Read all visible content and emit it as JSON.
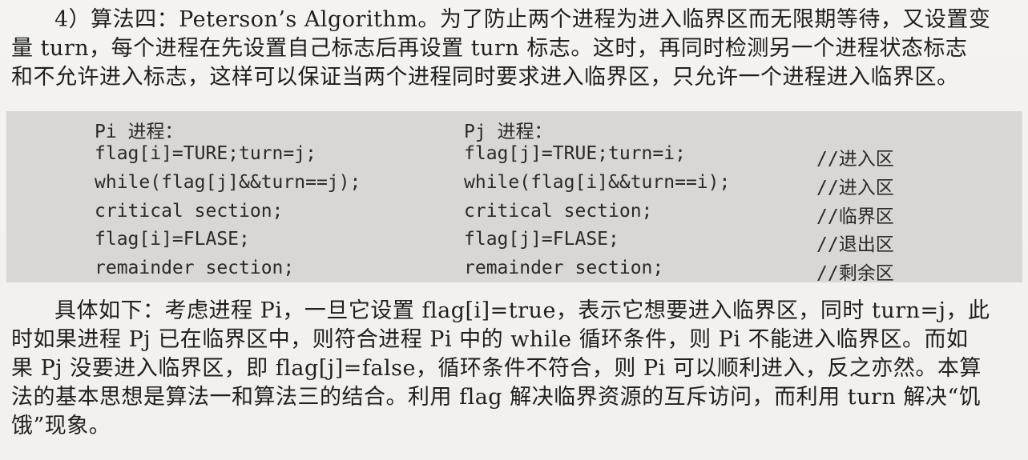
{
  "intro": {
    "line1": "4）算法四：Peterson’s Algorithm。为了防止两个进程为进入临界区而无限期等待，又设置变",
    "line2": "量 turn，每个进程在先设置自己标志后再设置 turn 标志。这时，再同时检测另一个进程状态标志",
    "line3": "和不允许进入标志，这样可以保证当两个进程同时要求进入临界区，只允许一个进程进入临界区。"
  },
  "code": {
    "rows": [
      {
        "pi": "Pi 进程：",
        "pj": "Pj 进程：",
        "comment": ""
      },
      {
        "pi": "flag[i]=TURE;turn=j;",
        "pj": "flag[j]=TRUE;turn=i;",
        "comment": "//进入区"
      },
      {
        "pi": "while(flag[j]&&turn==j);",
        "pj": "while(flag[i]&&turn==i);",
        "comment": "//进入区"
      },
      {
        "pi": "critical section;",
        "pj": "critical section;",
        "comment": "//临界区"
      },
      {
        "pi": "flag[i]=FLASE;",
        "pj": "flag[j]=FLASE;",
        "comment": "//退出区"
      },
      {
        "pi": "remainder section;",
        "pj": "remainder section;",
        "comment": "//剩余区"
      }
    ]
  },
  "explanation": {
    "line1": "具体如下：考虑进程 Pi，一旦它设置 flag[i]=true，表示它想要进入临界区，同时 turn=j，此",
    "line2": "时如果进程 Pj 已在临界区中，则符合进程 Pi 中的 while 循环条件，则 Pi 不能进入临界区。而如",
    "line3": "果 Pj 没要进入临界区，即 flag[j]=false，循环条件不符合，则 Pi 可以顺利进入，反之亦然。本算",
    "line4": "法的基本思想是算法一和算法三的结合。利用 flag 解决临界资源的互斥访问，而利用 turn 解决“饥",
    "line5": "饿”现象。"
  }
}
